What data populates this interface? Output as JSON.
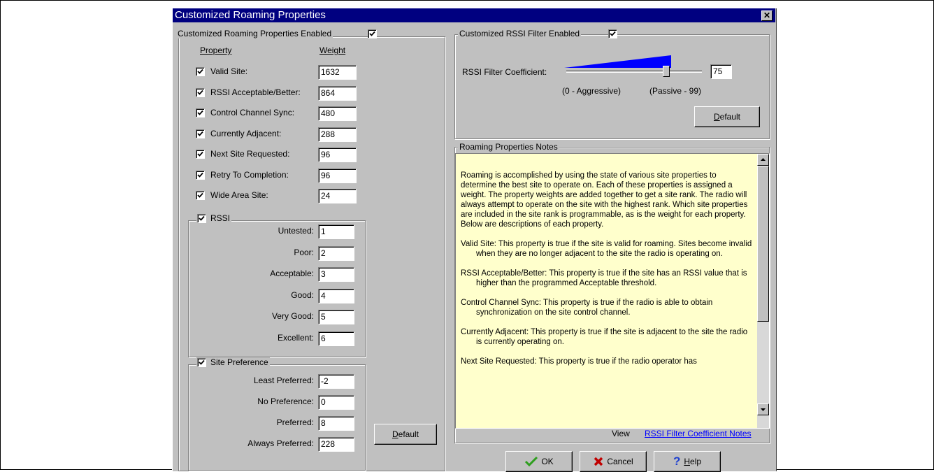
{
  "window": {
    "title": "Customized Roaming Properties",
    "close_glyph": "✕"
  },
  "left_group": {
    "legend": "Customized Roaming Properties Enabled",
    "enabled": true,
    "header_property": "Property",
    "header_weight": "Weight",
    "properties": [
      {
        "label": "Valid Site:",
        "weight": "1632",
        "checked": true
      },
      {
        "label": "RSSI Acceptable/Better:",
        "weight": "864",
        "checked": true
      },
      {
        "label": "Control Channel Sync:",
        "weight": "480",
        "checked": true
      },
      {
        "label": "Currently Adjacent:",
        "weight": "288",
        "checked": true
      },
      {
        "label": "Next Site Requested:",
        "weight": "96",
        "checked": true
      },
      {
        "label": "Retry To Completion:",
        "weight": "96",
        "checked": true
      },
      {
        "label": "Wide Area Site:",
        "weight": "24",
        "checked": true
      }
    ],
    "rssi": {
      "legend": "RSSI",
      "checked": true,
      "levels": [
        {
          "label": "Untested:",
          "value": "1"
        },
        {
          "label": "Poor:",
          "value": "2"
        },
        {
          "label": "Acceptable:",
          "value": "3"
        },
        {
          "label": "Good:",
          "value": "4"
        },
        {
          "label": "Very Good:",
          "value": "5"
        },
        {
          "label": "Excellent:",
          "value": "6"
        }
      ]
    },
    "site_preference": {
      "legend": "Site Preference",
      "checked": true,
      "levels": [
        {
          "label": "Least Preferred:",
          "value": "-2"
        },
        {
          "label": "No Preference:",
          "value": "0"
        },
        {
          "label": "Preferred:",
          "value": "8"
        },
        {
          "label": "Always Preferred:",
          "value": "228"
        }
      ]
    },
    "default_button": {
      "accel": "D",
      "rest": "efault"
    }
  },
  "rssi_filter": {
    "legend": "Customized RSSI Filter Enabled",
    "enabled": true,
    "coef_label": "RSSI Filter Coefficient:",
    "coef_value": "75",
    "slider_fraction": 0.75,
    "range_left": "(0 - Aggressive)",
    "range_right": "(Passive - 99)",
    "default_button": {
      "accel": "D",
      "rest": "efault"
    },
    "wedge_color": "#0000ff"
  },
  "notes": {
    "legend": "Roaming Properties Notes",
    "paragraphs": [
      "Roaming is accomplished by using the state of various site properties to  determine the best site to operate on.  Each of these properties is assigned a weight.  The property weights are added together to get a site rank.  The radio will always attempt to operate on the site with the highest rank.  Which site properties are included in the site rank is programmable, as is the weight for each property.  Below are descriptions of each property.",
      "Valid Site:  This property is true if the site is valid for roaming.  Sites become invalid when they are no longer adjacent to the site the radio is operating on.",
      "RSSI Acceptable/Better:  This property is true if the site has an RSSI value that is higher than the programmed Acceptable threshold.",
      "Control Channel Sync:  This property is true if the radio is able to obtain synchronization on the site control channel.",
      "Currently Adjacent:  This property is true if the site is adjacent to the site the radio is currently operating on.",
      "Next Site Requested:  This property is true if the radio operator has"
    ],
    "view_label": "View",
    "view_link": "RSSI Filter Coefficient Notes",
    "link_color": "#0000ff",
    "background": "#ffffcc"
  },
  "buttons": {
    "ok": {
      "label": "OK",
      "icon": "checkmark-icon"
    },
    "cancel": {
      "label": "Cancel",
      "icon": "x-icon"
    },
    "help": {
      "accel": "H",
      "rest": "elp",
      "icon": "question-mark-icon"
    }
  }
}
